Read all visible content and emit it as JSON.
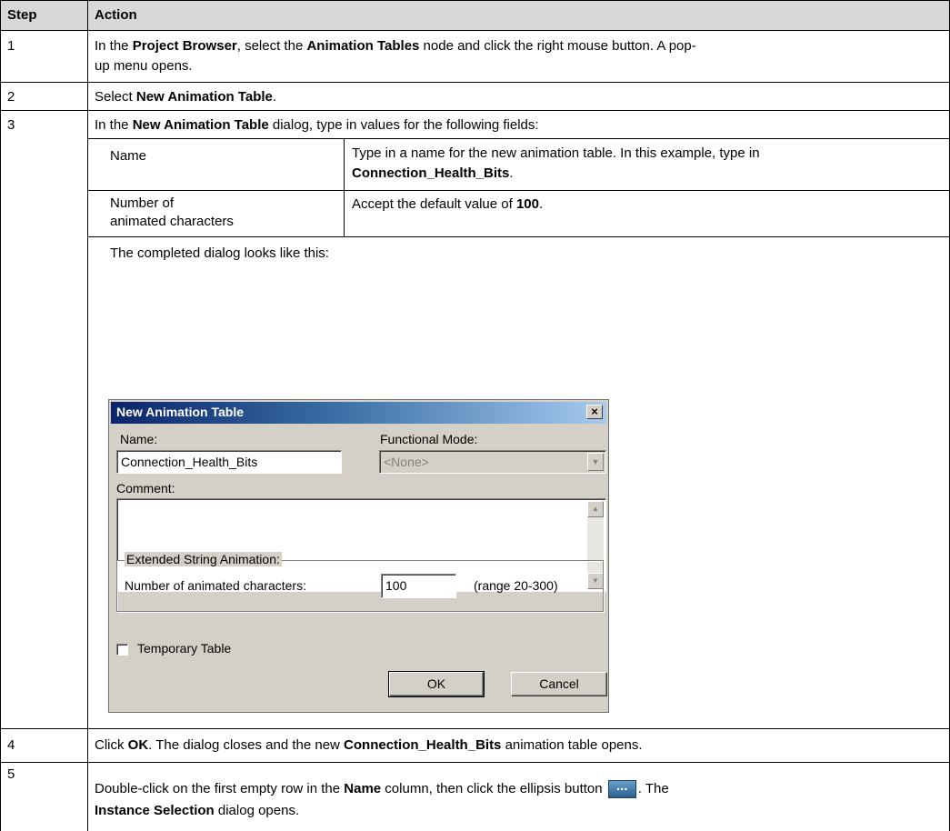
{
  "header": {
    "step": "Step",
    "action": "Action"
  },
  "rows": [
    {
      "step": "1",
      "line1": [
        "In the ",
        "Project Browser",
        ", select the ",
        "Animation Tables",
        " node and click the right mouse button. A pop-"
      ],
      "line2": "up menu opens."
    },
    {
      "step": "2",
      "parts": [
        "Select ",
        "New Animation Table",
        "."
      ]
    },
    {
      "step": "3",
      "parts": [
        "In the ",
        "New Animation Table",
        " dialog, type in values for the following fields:"
      ],
      "fields": [
        {
          "name": "Name",
          "desc_line1": "Type in a name for the new animation table. In this example, type in",
          "desc_line2": "Connection_Health_Bits",
          "desc_line2_suffix": "."
        },
        {
          "name_line1": "Number of",
          "name_line2": "animated characters",
          "desc": [
            "Accept the default value of ",
            "100",
            "."
          ]
        }
      ],
      "completed_text": "The completed dialog looks like this:"
    },
    {
      "step": "4",
      "parts": [
        "Click ",
        "OK",
        ". The dialog closes and the new ",
        "Connection_Health_Bits",
        " animation table opens."
      ]
    },
    {
      "step": "5",
      "line1": [
        "Double-click on the first empty row in the ",
        "Name",
        " column, then click the ellipsis button ",
        ". The"
      ],
      "line2": [
        "Instance Selection",
        " dialog opens."
      ],
      "ellipsis_glyph": "..."
    }
  ],
  "dialog": {
    "title": "New Animation Table",
    "close_glyph": "×",
    "name_label": "Name:",
    "name_value": "Connection_Health_Bits",
    "functional_mode_label": "Functional Mode:",
    "functional_mode_value": "<None>",
    "comment_label": "Comment:",
    "comment_value": "",
    "group_label": "Extended String Animation:",
    "chars_label": "Number of animated characters:",
    "chars_value": "100",
    "range_text": "(range 20-300)",
    "temporary_label": "Temporary Table",
    "ok_label": "OK",
    "cancel_label": "Cancel"
  }
}
